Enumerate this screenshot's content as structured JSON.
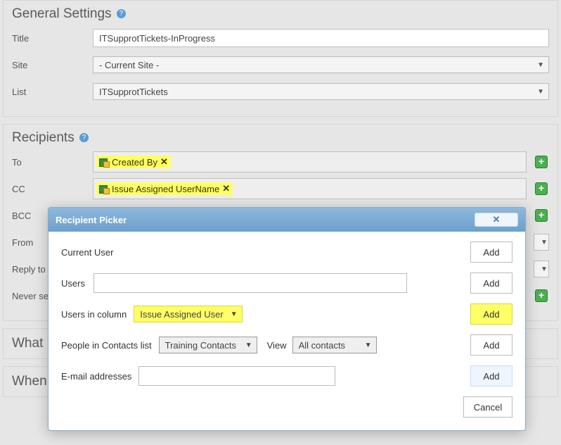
{
  "general": {
    "heading": "General Settings",
    "title_label": "Title",
    "title_value": "ITSupprotTickets-InProgress",
    "site_label": "Site",
    "site_value": "- Current Site -",
    "list_label": "List",
    "list_value": "ITSupprotTickets"
  },
  "recipients": {
    "heading": "Recipients",
    "to_label": "To",
    "to_tag": "Created By",
    "cc_label": "CC",
    "cc_tag": "Issue Assigned UserName",
    "bcc_label": "BCC",
    "from_label": "From",
    "reply_label": "Reply to",
    "never_label": "Never se"
  },
  "sections": {
    "what": "What",
    "when": "When"
  },
  "modal": {
    "title": "Recipient Picker",
    "current_user_label": "Current User",
    "users_label": "Users",
    "users_column_label": "Users in column",
    "users_column_value": "Issue Assigned User",
    "people_label": "People in Contacts list",
    "people_list_value": "Training Contacts",
    "view_label": "View",
    "view_value": "All contacts",
    "email_label": "E-mail addresses",
    "add_label": "Add",
    "cancel_label": "Cancel"
  }
}
